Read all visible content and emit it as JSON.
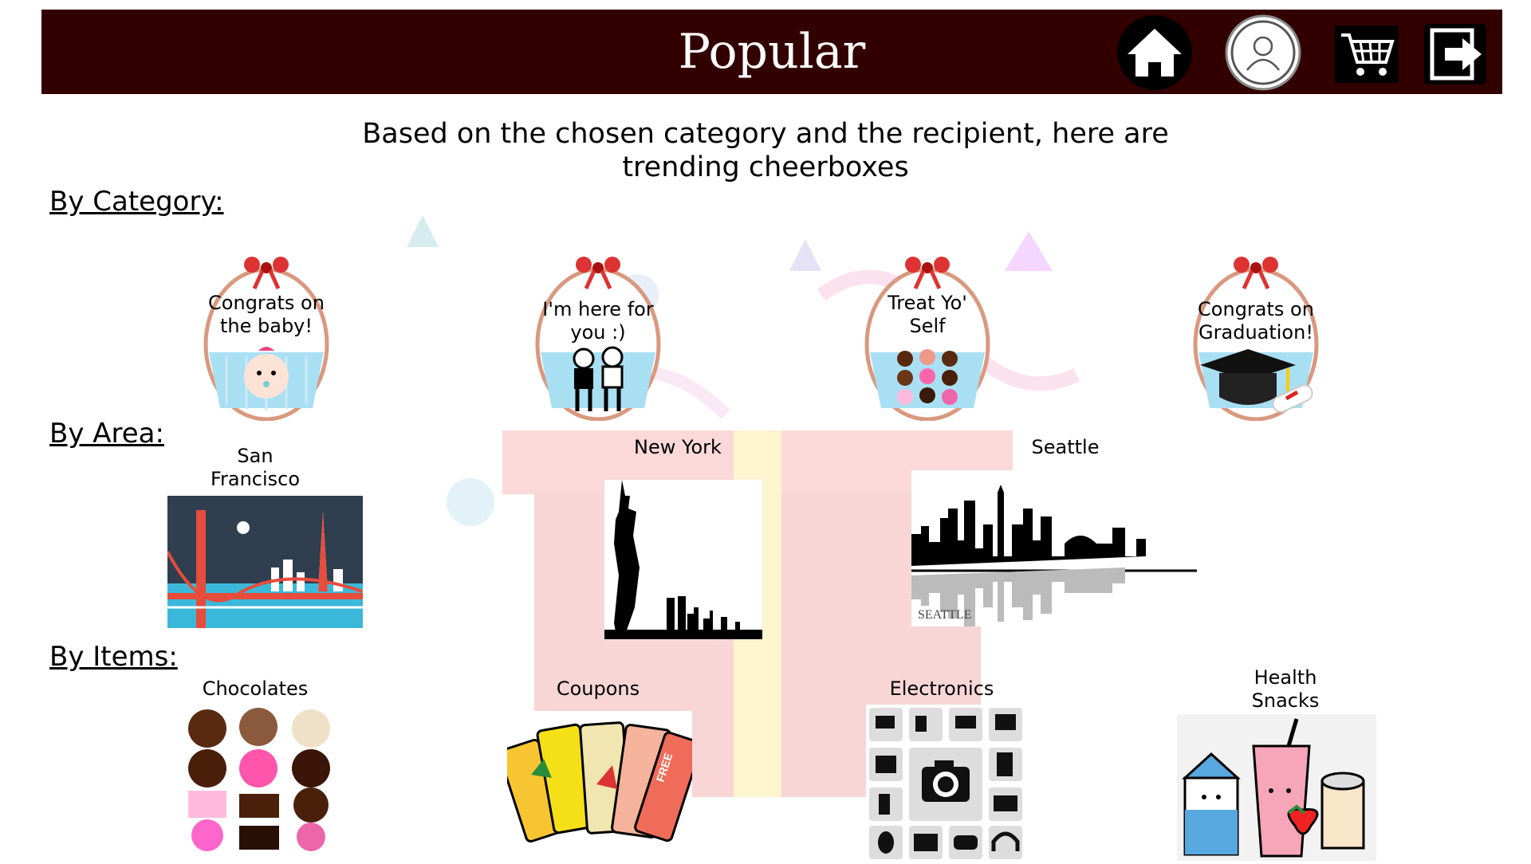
{
  "header": {
    "title": "Popular",
    "home_icon": "home-icon",
    "profile_icon": "user-icon",
    "cart_icon": "cart-icon",
    "logout_icon": "logout-icon",
    "color": "#330000"
  },
  "subtitle": "Based on the chosen category and the recipient, here are trending cheerboxes",
  "sections": {
    "category": "By Category:",
    "area": "By Area:",
    "items": "By Items:"
  },
  "categories": [
    {
      "label": "Congrats on the baby!",
      "icon": "baby-icon"
    },
    {
      "label": "I'm here for you :)",
      "icon": "friends-icon"
    },
    {
      "label": "Treat Yo' Self",
      "icon": "chocolates-icon"
    },
    {
      "label": "Congrats on Graduation!",
      "icon": "graduation-cap-icon"
    }
  ],
  "areas": [
    {
      "label": "San Francisco"
    },
    {
      "label": "New York"
    },
    {
      "label": "Seattle",
      "caption": "SEATTLE"
    }
  ],
  "items": [
    {
      "label": "Chocolates"
    },
    {
      "label": "Coupons",
      "coupon_texts": [
        "FREE"
      ]
    },
    {
      "label": "Electronics"
    },
    {
      "label": "Health Snacks"
    }
  ]
}
